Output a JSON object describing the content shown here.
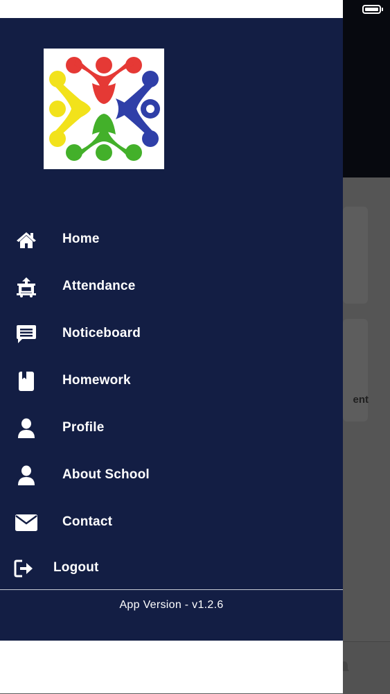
{
  "background": {
    "partial_text": "ent"
  },
  "logo": {
    "icon": "school-logo"
  },
  "menu": {
    "items": [
      {
        "label": "Home",
        "icon": "home-icon"
      },
      {
        "label": "Attendance",
        "icon": "attendance-icon"
      },
      {
        "label": "Noticeboard",
        "icon": "message-icon"
      },
      {
        "label": "Homework",
        "icon": "book-icon"
      },
      {
        "label": "Profile",
        "icon": "user-icon"
      },
      {
        "label": "About School",
        "icon": "user-icon"
      },
      {
        "label": "Contact",
        "icon": "envelope-icon"
      },
      {
        "label": "Logout",
        "icon": "logout-icon"
      }
    ]
  },
  "footer": {
    "version": "App Version - v1.2.6"
  },
  "colors": {
    "drawer_bg": "#131e44",
    "logo_red": "#e53935",
    "logo_blue": "#2f3fa8",
    "logo_green": "#43b02a",
    "logo_yellow": "#f2e21b"
  }
}
